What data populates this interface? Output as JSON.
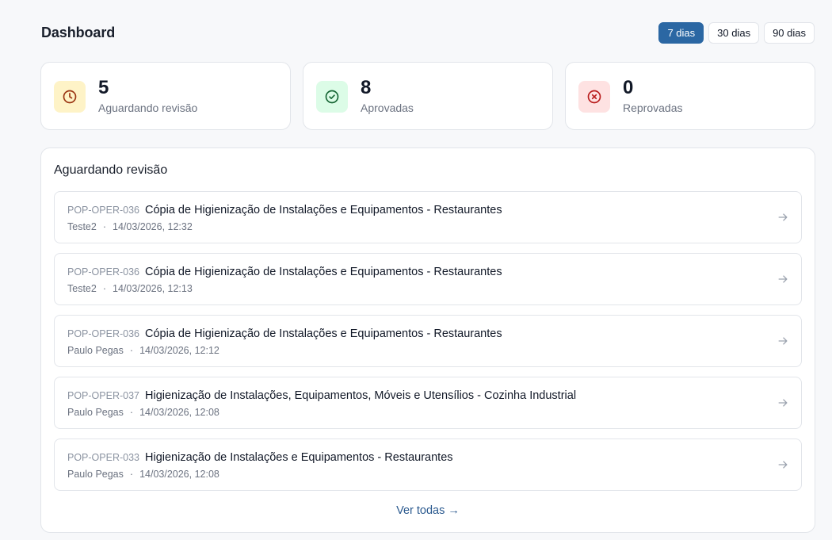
{
  "header": {
    "title": "Dashboard",
    "ranges": [
      {
        "label": "7 dias",
        "active": true
      },
      {
        "label": "30 dias",
        "active": false
      },
      {
        "label": "90 dias",
        "active": false
      }
    ]
  },
  "stats": [
    {
      "value": "5",
      "label": "Aguardando revisão",
      "icon": "clock-icon",
      "bg": "#fef3c7",
      "color": "#9a3412"
    },
    {
      "value": "8",
      "label": "Aprovadas",
      "icon": "check-circle-icon",
      "bg": "#dcfce7",
      "color": "#166534"
    },
    {
      "value": "0",
      "label": "Reprovadas",
      "icon": "x-circle-icon",
      "bg": "#fee2e2",
      "color": "#b91c1c"
    }
  ],
  "panel": {
    "title": "Aguardando revisão",
    "items": [
      {
        "code": "POP-OPER-036",
        "title": "Cópia de Higienização de Instalações e Equipamentos - Restaurantes",
        "author": "Teste2",
        "sep": "·",
        "date": "14/03/2026, 12:32"
      },
      {
        "code": "POP-OPER-036",
        "title": "Cópia de Higienização de Instalações e Equipamentos - Restaurantes",
        "author": "Teste2",
        "sep": "·",
        "date": "14/03/2026, 12:13"
      },
      {
        "code": "POP-OPER-036",
        "title": "Cópia de Higienização de Instalações e Equipamentos - Restaurantes",
        "author": "Paulo Pegas",
        "sep": "·",
        "date": "14/03/2026, 12:12"
      },
      {
        "code": "POP-OPER-037",
        "title": "Higienização de Instalações, Equipamentos, Móveis e Utensílios - Cozinha Industrial",
        "author": "Paulo Pegas",
        "sep": "·",
        "date": "14/03/2026, 12:08"
      },
      {
        "code": "POP-OPER-033",
        "title": "Higienização de Instalações e Equipamentos - Restaurantes",
        "author": "Paulo Pegas",
        "sep": "·",
        "date": "14/03/2026, 12:08"
      }
    ],
    "view_all": "Ver todas →"
  }
}
